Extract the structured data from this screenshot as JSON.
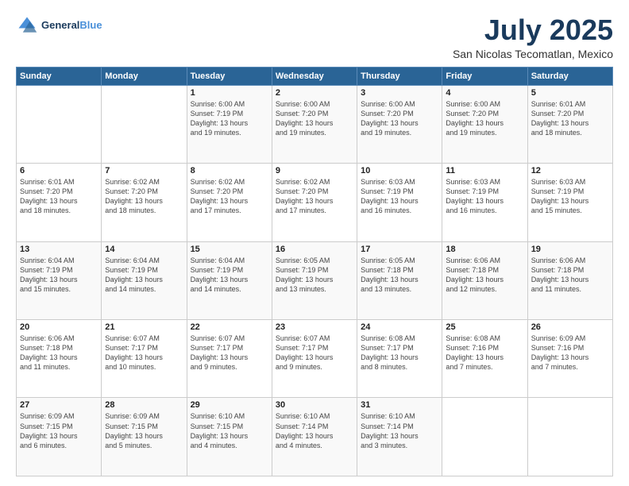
{
  "header": {
    "logo_line1": "General",
    "logo_line2": "Blue",
    "title": "July 2025",
    "subtitle": "San Nicolas Tecomatlan, Mexico"
  },
  "weekdays": [
    "Sunday",
    "Monday",
    "Tuesday",
    "Wednesday",
    "Thursday",
    "Friday",
    "Saturday"
  ],
  "weeks": [
    [
      {
        "day": "",
        "info": ""
      },
      {
        "day": "",
        "info": ""
      },
      {
        "day": "1",
        "info": "Sunrise: 6:00 AM\nSunset: 7:19 PM\nDaylight: 13 hours\nand 19 minutes."
      },
      {
        "day": "2",
        "info": "Sunrise: 6:00 AM\nSunset: 7:20 PM\nDaylight: 13 hours\nand 19 minutes."
      },
      {
        "day": "3",
        "info": "Sunrise: 6:00 AM\nSunset: 7:20 PM\nDaylight: 13 hours\nand 19 minutes."
      },
      {
        "day": "4",
        "info": "Sunrise: 6:00 AM\nSunset: 7:20 PM\nDaylight: 13 hours\nand 19 minutes."
      },
      {
        "day": "5",
        "info": "Sunrise: 6:01 AM\nSunset: 7:20 PM\nDaylight: 13 hours\nand 18 minutes."
      }
    ],
    [
      {
        "day": "6",
        "info": "Sunrise: 6:01 AM\nSunset: 7:20 PM\nDaylight: 13 hours\nand 18 minutes."
      },
      {
        "day": "7",
        "info": "Sunrise: 6:02 AM\nSunset: 7:20 PM\nDaylight: 13 hours\nand 18 minutes."
      },
      {
        "day": "8",
        "info": "Sunrise: 6:02 AM\nSunset: 7:20 PM\nDaylight: 13 hours\nand 17 minutes."
      },
      {
        "day": "9",
        "info": "Sunrise: 6:02 AM\nSunset: 7:20 PM\nDaylight: 13 hours\nand 17 minutes."
      },
      {
        "day": "10",
        "info": "Sunrise: 6:03 AM\nSunset: 7:19 PM\nDaylight: 13 hours\nand 16 minutes."
      },
      {
        "day": "11",
        "info": "Sunrise: 6:03 AM\nSunset: 7:19 PM\nDaylight: 13 hours\nand 16 minutes."
      },
      {
        "day": "12",
        "info": "Sunrise: 6:03 AM\nSunset: 7:19 PM\nDaylight: 13 hours\nand 15 minutes."
      }
    ],
    [
      {
        "day": "13",
        "info": "Sunrise: 6:04 AM\nSunset: 7:19 PM\nDaylight: 13 hours\nand 15 minutes."
      },
      {
        "day": "14",
        "info": "Sunrise: 6:04 AM\nSunset: 7:19 PM\nDaylight: 13 hours\nand 14 minutes."
      },
      {
        "day": "15",
        "info": "Sunrise: 6:04 AM\nSunset: 7:19 PM\nDaylight: 13 hours\nand 14 minutes."
      },
      {
        "day": "16",
        "info": "Sunrise: 6:05 AM\nSunset: 7:19 PM\nDaylight: 13 hours\nand 13 minutes."
      },
      {
        "day": "17",
        "info": "Sunrise: 6:05 AM\nSunset: 7:18 PM\nDaylight: 13 hours\nand 13 minutes."
      },
      {
        "day": "18",
        "info": "Sunrise: 6:06 AM\nSunset: 7:18 PM\nDaylight: 13 hours\nand 12 minutes."
      },
      {
        "day": "19",
        "info": "Sunrise: 6:06 AM\nSunset: 7:18 PM\nDaylight: 13 hours\nand 11 minutes."
      }
    ],
    [
      {
        "day": "20",
        "info": "Sunrise: 6:06 AM\nSunset: 7:18 PM\nDaylight: 13 hours\nand 11 minutes."
      },
      {
        "day": "21",
        "info": "Sunrise: 6:07 AM\nSunset: 7:17 PM\nDaylight: 13 hours\nand 10 minutes."
      },
      {
        "day": "22",
        "info": "Sunrise: 6:07 AM\nSunset: 7:17 PM\nDaylight: 13 hours\nand 9 minutes."
      },
      {
        "day": "23",
        "info": "Sunrise: 6:07 AM\nSunset: 7:17 PM\nDaylight: 13 hours\nand 9 minutes."
      },
      {
        "day": "24",
        "info": "Sunrise: 6:08 AM\nSunset: 7:17 PM\nDaylight: 13 hours\nand 8 minutes."
      },
      {
        "day": "25",
        "info": "Sunrise: 6:08 AM\nSunset: 7:16 PM\nDaylight: 13 hours\nand 7 minutes."
      },
      {
        "day": "26",
        "info": "Sunrise: 6:09 AM\nSunset: 7:16 PM\nDaylight: 13 hours\nand 7 minutes."
      }
    ],
    [
      {
        "day": "27",
        "info": "Sunrise: 6:09 AM\nSunset: 7:15 PM\nDaylight: 13 hours\nand 6 minutes."
      },
      {
        "day": "28",
        "info": "Sunrise: 6:09 AM\nSunset: 7:15 PM\nDaylight: 13 hours\nand 5 minutes."
      },
      {
        "day": "29",
        "info": "Sunrise: 6:10 AM\nSunset: 7:15 PM\nDaylight: 13 hours\nand 4 minutes."
      },
      {
        "day": "30",
        "info": "Sunrise: 6:10 AM\nSunset: 7:14 PM\nDaylight: 13 hours\nand 4 minutes."
      },
      {
        "day": "31",
        "info": "Sunrise: 6:10 AM\nSunset: 7:14 PM\nDaylight: 13 hours\nand 3 minutes."
      },
      {
        "day": "",
        "info": ""
      },
      {
        "day": "",
        "info": ""
      }
    ]
  ]
}
